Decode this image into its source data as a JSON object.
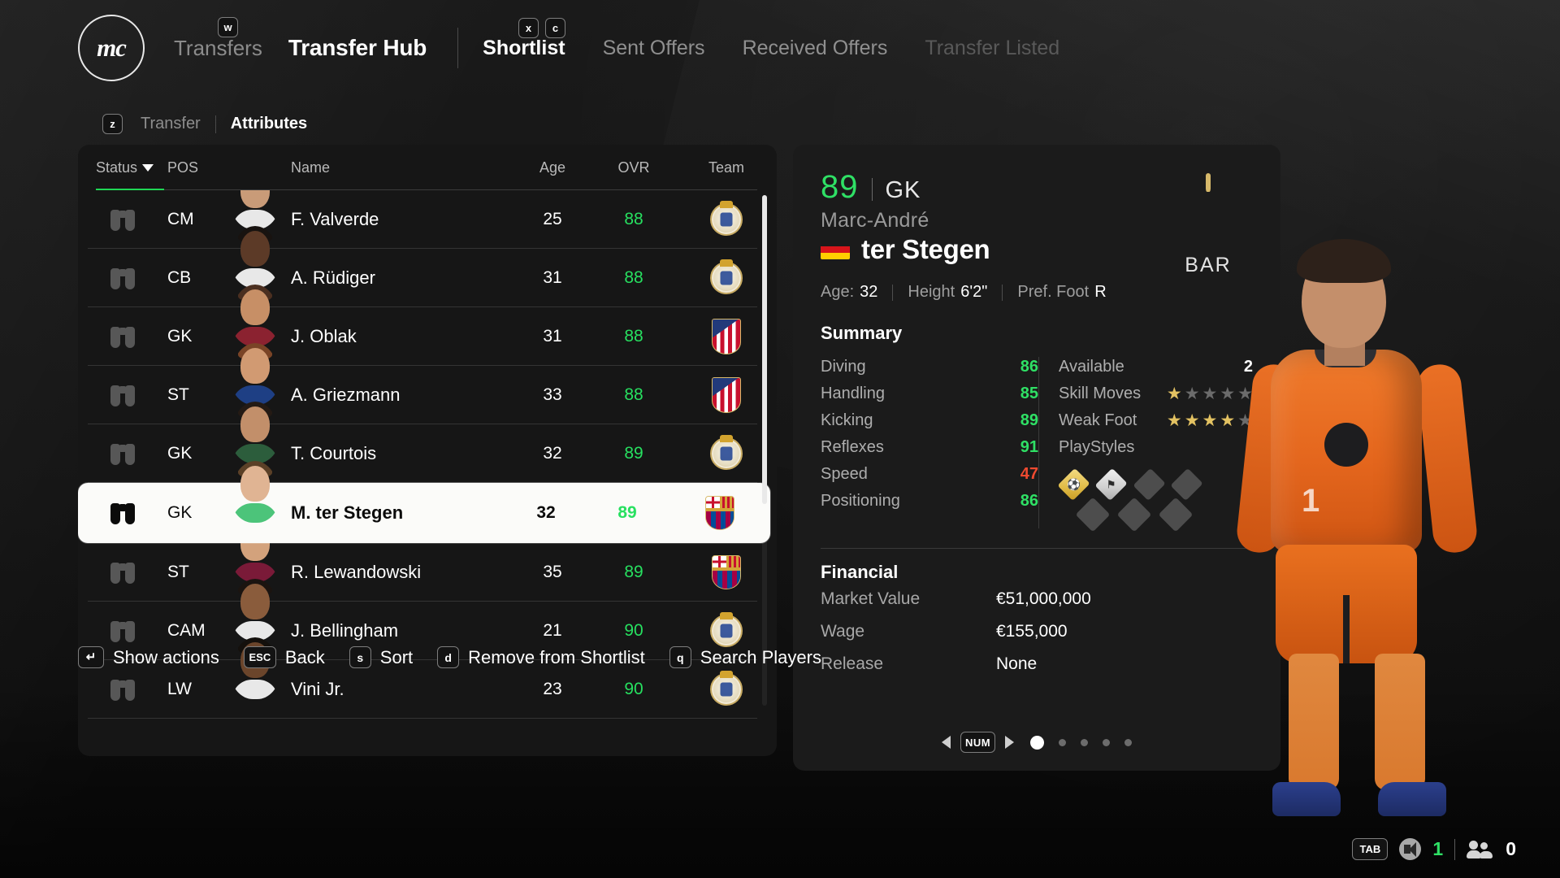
{
  "header": {
    "logo_text": "mc",
    "breadcrumb_parent": "Transfers",
    "breadcrumb_current": "Transfer Hub",
    "key_w": "w",
    "key_x": "x",
    "key_c": "c",
    "tabs": [
      {
        "label": "Shortlist",
        "state": "active"
      },
      {
        "label": "Sent Offers",
        "state": "normal"
      },
      {
        "label": "Received Offers",
        "state": "normal"
      },
      {
        "label": "Transfer Listed",
        "state": "disabled"
      }
    ]
  },
  "subnav": {
    "key": "z",
    "items": [
      {
        "label": "Transfer",
        "state": "normal"
      },
      {
        "label": "Attributes",
        "state": "active"
      }
    ]
  },
  "list": {
    "columns": {
      "status": "Status",
      "pos": "POS",
      "name": "Name",
      "age": "Age",
      "ovr": "OVR",
      "team": "Team"
    },
    "sort_indicator": "descending",
    "rows": [
      {
        "pos": "CM",
        "name": "F. Valverde",
        "age": "25",
        "ovr": "88",
        "team": "rm",
        "selected": false
      },
      {
        "pos": "CB",
        "name": "A. Rüdiger",
        "age": "31",
        "ovr": "88",
        "team": "rm",
        "selected": false
      },
      {
        "pos": "GK",
        "name": "J. Oblak",
        "age": "31",
        "ovr": "88",
        "team": "atm",
        "selected": false
      },
      {
        "pos": "ST",
        "name": "A. Griezmann",
        "age": "33",
        "ovr": "88",
        "team": "atm",
        "selected": false
      },
      {
        "pos": "GK",
        "name": "T. Courtois",
        "age": "32",
        "ovr": "89",
        "team": "rm",
        "selected": false
      },
      {
        "pos": "GK",
        "name": "M. ter Stegen",
        "age": "32",
        "ovr": "89",
        "team": "bar",
        "selected": true
      },
      {
        "pos": "ST",
        "name": "R. Lewandowski",
        "age": "35",
        "ovr": "89",
        "team": "bar",
        "selected": false
      },
      {
        "pos": "CAM",
        "name": "J. Bellingham",
        "age": "21",
        "ovr": "90",
        "team": "rm",
        "selected": false
      },
      {
        "pos": "LW",
        "name": "Vini Jr.",
        "age": "23",
        "ovr": "90",
        "team": "rm",
        "selected": false
      }
    ]
  },
  "detail": {
    "ovr": "89",
    "position": "GK",
    "first_name": "Marc-André",
    "last_name": "ter Stegen",
    "nationality": "Germany",
    "age_label": "Age:",
    "age_value": "32",
    "height_label": "Height",
    "height_value": "6'2\"",
    "foot_label": "Pref. Foot",
    "foot_value": "R",
    "club_code": "BAR",
    "summary_title": "Summary",
    "attributes": [
      {
        "label": "Diving",
        "value": "86",
        "tone": "good"
      },
      {
        "label": "Handling",
        "value": "85",
        "tone": "good"
      },
      {
        "label": "Kicking",
        "value": "89",
        "tone": "good"
      },
      {
        "label": "Reflexes",
        "value": "91",
        "tone": "good"
      },
      {
        "label": "Speed",
        "value": "47",
        "tone": "bad"
      },
      {
        "label": "Positioning",
        "value": "86",
        "tone": "good"
      }
    ],
    "meta": {
      "available_label": "Available",
      "available_value": "2",
      "skill_moves_label": "Skill Moves",
      "skill_moves_value": 1,
      "skill_moves_max": 5,
      "weak_foot_label": "Weak Foot",
      "weak_foot_value": 4,
      "weak_foot_max": 5,
      "playstyles_label": "PlayStyles",
      "playstyles": [
        {
          "name": "footwork-playstyle",
          "tier": "gold",
          "glyph": "⚽"
        },
        {
          "name": "rush-out-playstyle",
          "tier": "silver",
          "glyph": "⚑"
        },
        {
          "name": "empty-playstyle-1",
          "tier": "empty",
          "glyph": ""
        },
        {
          "name": "empty-playstyle-2",
          "tier": "empty",
          "glyph": ""
        },
        {
          "name": "empty-playstyle-3",
          "tier": "empty",
          "glyph": ""
        },
        {
          "name": "empty-playstyle-4",
          "tier": "empty",
          "glyph": ""
        },
        {
          "name": "empty-playstyle-5",
          "tier": "empty",
          "glyph": ""
        }
      ]
    },
    "financial_title": "Financial",
    "financial": [
      {
        "label": "Market Value",
        "value": "€51,000,000"
      },
      {
        "label": "Wage",
        "value": "€155,000"
      },
      {
        "label": "Release",
        "value": "None"
      }
    ],
    "pager": {
      "key": "NUM",
      "pages": 5,
      "active_page": 1
    }
  },
  "actions": [
    {
      "key": "↵",
      "label": "Show actions",
      "key_class": "enter"
    },
    {
      "key": "ESC",
      "label": "Back",
      "key_class": "esc"
    },
    {
      "key": "s",
      "label": "Sort",
      "key_class": ""
    },
    {
      "key": "d",
      "label": "Remove from Shortlist",
      "key_class": ""
    },
    {
      "key": "q",
      "label": "Search Players",
      "key_class": ""
    }
  ],
  "status_bar": {
    "key": "TAB",
    "volume_value": "1",
    "players_value": "0"
  },
  "colors": {
    "accent_green": "#2fe065",
    "accent_red": "#ef4a30",
    "selected_row_bg": "#fbfbf9",
    "panel_bg": "#161616",
    "card_bg": "#1b1b1b"
  }
}
